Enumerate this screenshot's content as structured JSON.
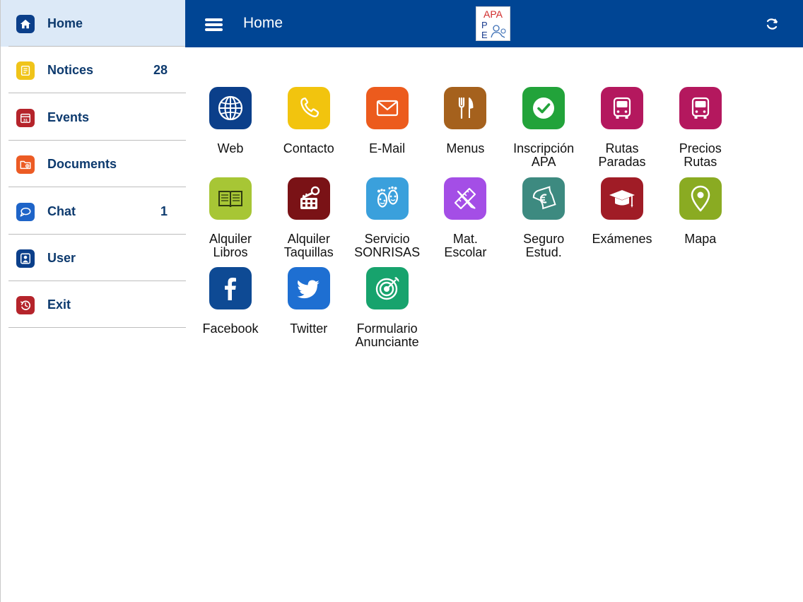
{
  "sidebar": {
    "items": [
      {
        "label": "Home",
        "badge": "",
        "icon": "home-icon",
        "color": "#0b3f8a",
        "active": true
      },
      {
        "label": "Notices",
        "badge": "28",
        "icon": "notices-icon",
        "color": "#f0c419"
      },
      {
        "label": "Events",
        "badge": "",
        "icon": "calendar-icon",
        "color": "#b5242b"
      },
      {
        "label": "Documents",
        "badge": "",
        "icon": "folder-icon",
        "color": "#ec5b24"
      },
      {
        "label": "Chat",
        "badge": "1",
        "icon": "chat-icon",
        "color": "#1e64c8"
      },
      {
        "label": "User",
        "badge": "",
        "icon": "user-icon",
        "color": "#0b3f8a"
      },
      {
        "label": "Exit",
        "badge": "",
        "icon": "exit-icon",
        "color": "#b5242b"
      }
    ]
  },
  "header": {
    "title": "Home",
    "logo_text": [
      "APA",
      "P",
      "E"
    ],
    "menu_icon": "hamburger-icon",
    "refresh_icon": "refresh-icon"
  },
  "tiles": [
    {
      "lines": [
        "Web"
      ],
      "icon": "globe-icon",
      "color": "#0b3f8a"
    },
    {
      "lines": [
        "Contacto"
      ],
      "icon": "phone-icon",
      "color": "#f2c40e"
    },
    {
      "lines": [
        "E-Mail"
      ],
      "icon": "envelope-icon",
      "color": "#ec5b1d"
    },
    {
      "lines": [
        "Menus"
      ],
      "icon": "cutlery-icon",
      "color": "#a5611d"
    },
    {
      "lines": [
        "Inscripción",
        "APA"
      ],
      "icon": "check-icon",
      "color": "#22a33a"
    },
    {
      "lines": [
        "Rutas",
        "Paradas"
      ],
      "icon": "bus-icon",
      "color": "#b4185e"
    },
    {
      "lines": [
        "Precios",
        "Rutas"
      ],
      "icon": "bus-icon",
      "color": "#b4185e"
    },
    {
      "lines": [
        "Alquiler",
        "Libros"
      ],
      "icon": "book-icon",
      "color": "#a7c635"
    },
    {
      "lines": [
        "Alquiler",
        "Taquillas"
      ],
      "icon": "locker-key-icon",
      "color": "#7a1216"
    },
    {
      "lines": [
        "Servicio",
        "SONRISAS"
      ],
      "icon": "footprints-icon",
      "color": "#3aa0dc"
    },
    {
      "lines": [
        "Mat.",
        "Escolar"
      ],
      "icon": "pencil-ruler-icon",
      "color": "#a44ee6"
    },
    {
      "lines": [
        "Seguro",
        "Estud."
      ],
      "icon": "euro-note-icon",
      "color": "#3d8a80"
    },
    {
      "lines": [
        "Exámenes"
      ],
      "icon": "graduation-cap-icon",
      "color": "#a01c26"
    },
    {
      "lines": [
        "Mapa"
      ],
      "icon": "map-pin-icon",
      "color": "#8aab22"
    },
    {
      "lines": [
        "Facebook"
      ],
      "icon": "facebook-icon",
      "color": "#0e4a94"
    },
    {
      "lines": [
        "Twitter"
      ],
      "icon": "twitter-icon",
      "color": "#1e6fd2"
    },
    {
      "lines": [
        "Formulario",
        "Anunciante"
      ],
      "icon": "target-icon",
      "color": "#17a36d"
    }
  ]
}
